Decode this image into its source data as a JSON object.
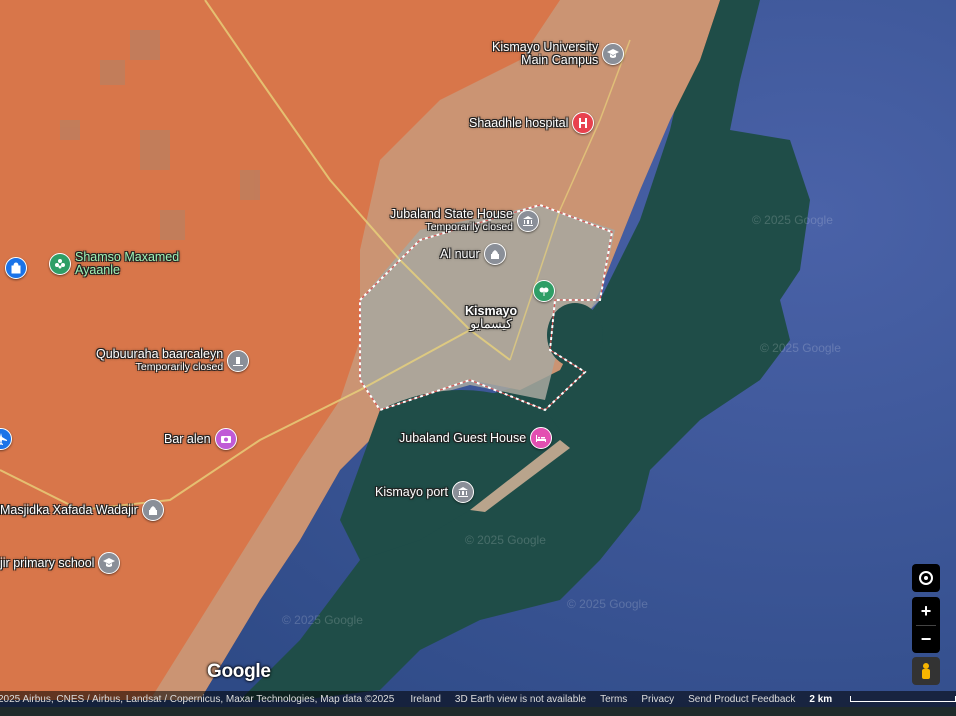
{
  "pois": [
    {
      "id": "kismayo-university",
      "lines": [
        "Kismayo University",
        "Main Campus"
      ],
      "icon": "graduation-cap-icon",
      "color": "#8a8f98"
    },
    {
      "id": "shaadhle-hospital",
      "lines": [
        "Shaadhle hospital"
      ],
      "icon": "hospital-icon",
      "color": "#e8414e"
    },
    {
      "id": "jubaland-state-house",
      "lines": [
        "Jubaland State House"
      ],
      "sub": "Temporarily closed",
      "icon": "government-building-icon",
      "color": "#8a8f98"
    },
    {
      "id": "al-nuur",
      "lines": [
        "Al nuur"
      ],
      "icon": "mosque-icon",
      "color": "#8a8f98"
    },
    {
      "id": "city-park",
      "lines": [],
      "icon": "park-icon",
      "color": "#2e9e66"
    },
    {
      "id": "kismayo",
      "lines": [
        "Kismayo",
        "كيسمايو"
      ],
      "icon": "",
      "color": ""
    },
    {
      "id": "shamso-maxamed-ayaanle",
      "lines": [
        "Shamso Maxamed",
        "Ayaanle"
      ],
      "icon": "flower-icon",
      "color": "#2e9e66"
    },
    {
      "id": "left-shop",
      "lines": [],
      "icon": "shopping-bag-icon",
      "color": "#1a73e8"
    },
    {
      "id": "qubuuraha-baarcaleyn",
      "lines": [
        "Qubuuraha baarcaleyn"
      ],
      "sub": "Temporarily closed",
      "icon": "cemetery-icon",
      "color": "#8a8f98"
    },
    {
      "id": "bar-alen",
      "lines": [
        "Bar alen"
      ],
      "icon": "camera-icon",
      "color": "#c05bd6"
    },
    {
      "id": "left-airport",
      "lines": [],
      "icon": "airplane-icon",
      "color": "#1a73e8"
    },
    {
      "id": "jubaland-guest-house",
      "lines": [
        "Jubaland Guest House"
      ],
      "icon": "bed-icon",
      "color": "#e34fb1"
    },
    {
      "id": "kismayo-port",
      "lines": [
        "Kismayo port"
      ],
      "icon": "landmark-icon",
      "color": "#8a8f98"
    },
    {
      "id": "masjidka-xafada-wadajir",
      "lines": [
        "Masjidka Xafada Wadajir"
      ],
      "icon": "mosque-icon",
      "color": "#8a8f98"
    },
    {
      "id": "primary-school",
      "lines": [
        "jir primary school"
      ],
      "icon": "graduation-cap-icon",
      "color": "#8a8f98"
    }
  ],
  "watermarks": [
    "© 2025 Google",
    "© 2025 Google",
    "© 2025 Google",
    "© 2025 Google",
    "© 2025 Google"
  ],
  "logo": "Google",
  "footer": {
    "attribution": "2025 Airbus, CNES / Airbus, Landsat / Copernicus, Maxar Technologies, Map data ©2025",
    "country": "Ireland",
    "earth_note": "3D Earth view is not available",
    "terms": "Terms",
    "privacy": "Privacy",
    "feedback": "Send Product Feedback",
    "scale": "2 km"
  },
  "controls": {
    "my_location": "my-location-icon",
    "zoom_in": "+",
    "zoom_out": "−",
    "pegman": "pegman-icon"
  },
  "colors": {
    "land": "#d8764a",
    "sea_deep": "#2d4c8c",
    "sea_shallow": "#1f4d48",
    "city": "#a8a8a0",
    "boundary": "#ffffff"
  }
}
